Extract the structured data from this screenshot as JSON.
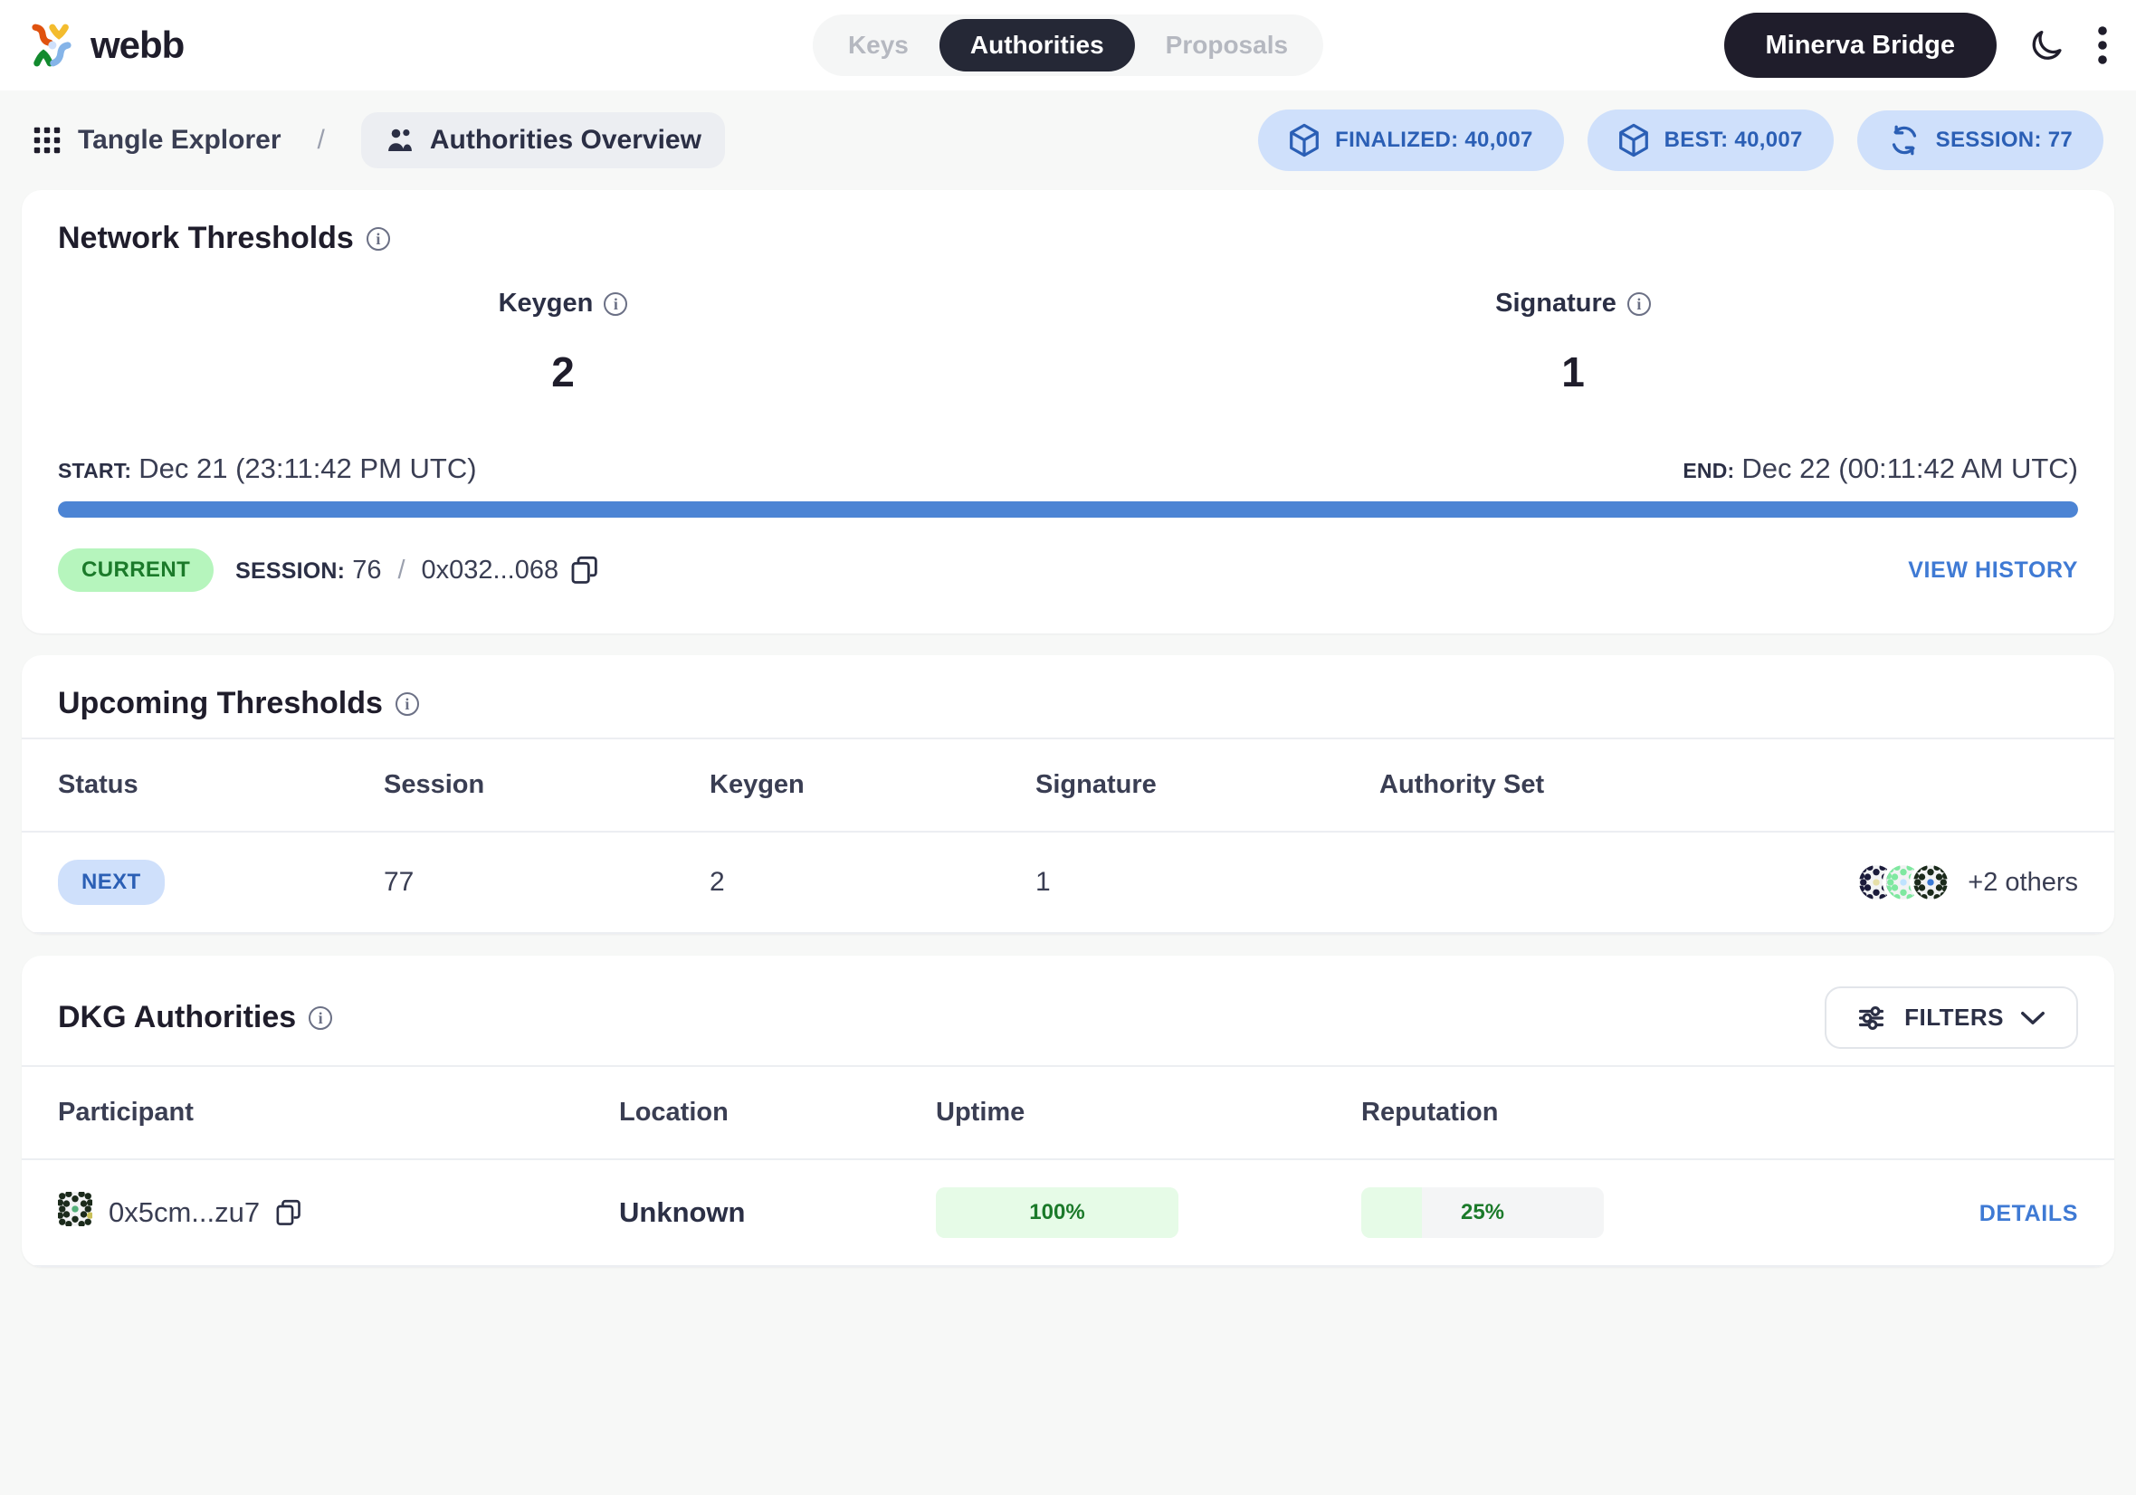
{
  "header": {
    "brand": "webb",
    "logo_icon": "webb-logo-icon",
    "tabs": [
      {
        "label": "Keys",
        "active": false
      },
      {
        "label": "Authorities",
        "active": true
      },
      {
        "label": "Proposals",
        "active": false
      }
    ],
    "chain_button": "Minerva Bridge",
    "theme_icon": "moon-icon",
    "menu_icon": "vertical-dots-icon"
  },
  "breadcrumb": {
    "grid_icon": "grid-icon",
    "root": "Tangle Explorer",
    "separator": "/",
    "current_icon": "users-icon",
    "current": "Authorities Overview"
  },
  "status_chips": [
    {
      "icon": "cube-icon",
      "label": "FINALIZED: 40,007"
    },
    {
      "icon": "cube-icon",
      "label": "BEST: 40,007"
    },
    {
      "icon": "refresh-icon",
      "label": "SESSION: 77"
    }
  ],
  "network_thresholds": {
    "title": "Network Thresholds",
    "info_icon": "info-icon",
    "stats": [
      {
        "label": "Keygen",
        "value": "2",
        "info_icon": "info-icon"
      },
      {
        "label": "Signature",
        "value": "1",
        "info_icon": "info-icon"
      }
    ],
    "start_label": "START:",
    "start_value": "Dec 21 (23:11:42 PM UTC)",
    "end_label": "END:",
    "end_value": "Dec 22 (00:11:42 AM UTC)",
    "progress_percent": 100,
    "badge": "CURRENT",
    "session_label": "SESSION:",
    "session_value": "76",
    "session_separator": "/",
    "session_hash": "0x032...068",
    "copy_icon": "copy-icon",
    "view_history": "VIEW HISTORY"
  },
  "upcoming_thresholds": {
    "title": "Upcoming Thresholds",
    "info_icon": "info-icon",
    "columns": [
      "Status",
      "Session",
      "Keygen",
      "Signature",
      "Authority Set"
    ],
    "rows": [
      {
        "status": "NEXT",
        "session": "77",
        "keygen": "2",
        "signature": "1",
        "authority_set_more": "+2 others",
        "avatar_count": 3
      }
    ]
  },
  "dkg_authorities": {
    "title": "DKG Authorities",
    "info_icon": "info-icon",
    "filters_label": "FILTERS",
    "filters_icon": "sliders-icon",
    "filters_chevron": "chevron-down-icon",
    "columns": [
      "Participant",
      "Location",
      "Uptime",
      "Reputation",
      ""
    ],
    "rows": [
      {
        "avatar_icon": "identicon-avatar",
        "participant": "0x5cm...zu7",
        "copy_icon": "copy-icon",
        "location": "Unknown",
        "uptime": "100%",
        "uptime_percent": 100,
        "reputation": "25%",
        "reputation_percent": 25,
        "details": "DETAILS"
      }
    ]
  },
  "colors": {
    "accent_blue": "#4c84d4",
    "link_blue": "#3f7ad4",
    "chip_bg": "#cfe0fb",
    "chip_text": "#2b5fb5",
    "green_badge_bg": "#b6f5bd",
    "green_badge_text": "#1b7a2a",
    "dark": "#1f1d2b"
  }
}
